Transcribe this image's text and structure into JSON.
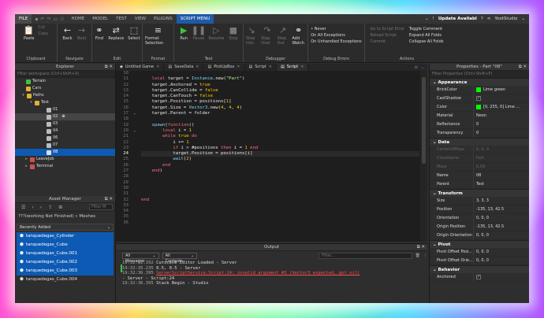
{
  "menu": {
    "file": "FILE",
    "tabs": [
      "HOME",
      "MODEL",
      "TEST",
      "VIEW",
      "PLUGINS",
      "SCRIPT MENU"
    ],
    "update": "Update Availabl",
    "user": "YootStudio"
  },
  "ribbon": {
    "clipboard": {
      "paste": "Paste",
      "cut": "Cut",
      "copy": "Copy",
      "caption": "Clipboard"
    },
    "navigate": {
      "back": "Back",
      "next": "Next",
      "caption": "Navigate"
    },
    "edit": {
      "find": "Find",
      "replace": "Replace",
      "select": "Select",
      "caption": "Edit"
    },
    "format": {
      "format_selection": "Format Selection",
      "caption": "Format"
    },
    "test": {
      "run": "Run",
      "pause": "Pause",
      "resume": "Resume",
      "stop": "Stop",
      "caption": "Test"
    },
    "debugger": {
      "step_into": "Step Into",
      "step_over": "Step Over",
      "step_out": "Step Out",
      "add_watch": "Add Watch",
      "caption": "Debugger"
    },
    "debug_errors": {
      "never": "Never",
      "all_exceptions": "On All Exceptions",
      "unhandled": "On Unhandled Exceptions",
      "caption": "Debug Errors"
    },
    "actions": {
      "goto_script_error": "Go to Script Error",
      "reload_script": "Reload Script",
      "commit": "Commit",
      "toggle_comment": "Toggle Comment",
      "expand_all": "Expand All Folds",
      "collapse_all": "Collapse All Folds",
      "caption": "Actions"
    }
  },
  "explorer": {
    "title": "Explorer",
    "filter_placeholder": "Filter workspace (Ctrl+Shift+X)",
    "items": [
      {
        "label": "Terrain"
      },
      {
        "label": "Cars"
      },
      {
        "label": "Paths"
      },
      {
        "label": "Test"
      },
      {
        "label": "01"
      },
      {
        "label": "02"
      },
      {
        "label": "03"
      },
      {
        "label": "04"
      },
      {
        "label": "06"
      },
      {
        "label": "07"
      },
      {
        "label": "08"
      },
      {
        "label": "LeaveJob"
      },
      {
        "label": "Terminal"
      }
    ]
  },
  "asset_manager": {
    "title": "Asset Manager",
    "search_placeholder": "Filter M",
    "path": "???(working Not Finished)  »  Meshes",
    "dropdown": "Recently Added",
    "items": [
      "tanquedegas_Cylinder",
      "tanquedegas_Cube",
      "tanquedegas_Cube.001",
      "tanquedegas_Cube.002",
      "tanquedegas_Cube.003",
      "tanquedegas_Cube.004"
    ]
  },
  "tabs": [
    {
      "label": "Untitled Game"
    },
    {
      "label": "SaveData"
    },
    {
      "label": "PickUpBox"
    },
    {
      "label": "Script"
    },
    {
      "label": "Script"
    }
  ],
  "editor": {
    "line_numbers": [
      "10",
      "11",
      "12",
      "13",
      "14",
      "15",
      "16",
      "17",
      "18",
      "19",
      "20",
      "21",
      "22",
      "23",
      "24",
      "25",
      "26",
      "27",
      "28",
      "29",
      "30",
      "31",
      "32",
      "33",
      "34",
      "35",
      "36"
    ],
    "current_line": "24"
  },
  "output": {
    "title": "Output",
    "messages_dd": "All Messages",
    "contexts_dd": "All Contexts",
    "filter_placeholder": "Filter...",
    "lines": [
      {
        "ts": "19:32:32.392",
        "text": "Cutscene Editor Loaded  -  Server",
        "kind": "info"
      },
      {
        "ts": "19:32:35.235",
        "text": "0.5, 0.5  -  Server",
        "kind": "info"
      },
      {
        "ts": "19:32:36.395",
        "text": "ServerScriptService.Script:24: invalid argument #3 (Vector3 expected, got nil)",
        "kind": "err"
      },
      {
        "ts": "",
        "text": "  -  Server - Script:24",
        "kind": "info"
      },
      {
        "ts": "19:32:36.395",
        "text": "Stack Begin  -  Studio",
        "kind": "info"
      }
    ]
  },
  "properties": {
    "title": "Properties - Part \"08\"",
    "filter_placeholder": "Filter Properties (Ctrl+Shift+P)",
    "sections": [
      {
        "name": "Appearance",
        "rows": [
          {
            "name": "BrickColor",
            "value": "Lime green",
            "swatch": "#00ff00"
          },
          {
            "name": "CastShadow",
            "value": "",
            "check": true
          },
          {
            "name": "Color",
            "value": "[0, 255, 0] Lime ...",
            "swatch": "#00ff00"
          },
          {
            "name": "Material",
            "value": "Neon"
          },
          {
            "name": "Reflectance",
            "value": "0"
          },
          {
            "name": "Transparency",
            "value": "0"
          }
        ]
      },
      {
        "name": "Data",
        "rows": [
          {
            "name": "CenterOfMass",
            "value": "0, 0, 0",
            "dim": true
          },
          {
            "name": "ClassName",
            "value": "Part",
            "dim": true
          },
          {
            "name": "Mass",
            "value": "0.09",
            "dim": true
          },
          {
            "name": "Name",
            "value": "08"
          },
          {
            "name": "Parent",
            "value": "Test"
          }
        ]
      },
      {
        "name": "Transform",
        "rows": [
          {
            "name": "Size",
            "value": "3, 3, 3"
          },
          {
            "name": "Position",
            "value": "-135, 13, 42.5"
          },
          {
            "name": "Orientation",
            "value": "0, 0, 0"
          },
          {
            "name": "Origin Position",
            "value": "-135, 13, 42.5"
          },
          {
            "name": "Origin Orientation",
            "value": "0, 0, 0"
          }
        ]
      },
      {
        "name": "Pivot",
        "rows": [
          {
            "name": "Pivot Offset Posi...",
            "value": "0, 0, 0"
          },
          {
            "name": "Pivot Offset Orie...",
            "value": "0, 0, 0"
          }
        ]
      },
      {
        "name": "Behavior",
        "rows": [
          {
            "name": "Anchored",
            "value": "",
            "check": true
          }
        ]
      }
    ]
  }
}
